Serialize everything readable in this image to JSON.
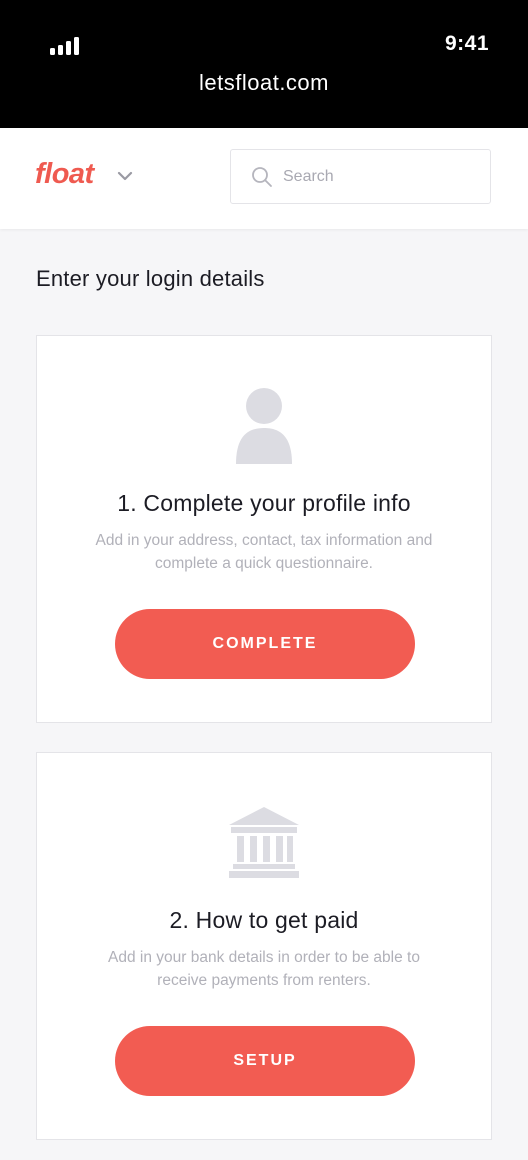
{
  "status_bar": {
    "time": "9:41",
    "url": "letsfloat.com"
  },
  "header": {
    "logo_text": "float",
    "logo_menu_icon": "chevron-down-icon",
    "search": {
      "icon": "search-icon",
      "placeholder": "Search"
    }
  },
  "page": {
    "title": "Enter your login details"
  },
  "cards": [
    {
      "icon": "user-icon",
      "title": "1. Complete your profile info",
      "description": "Add in your address, contact, tax information and complete a quick questionnaire.",
      "button_label": "COMPLETE"
    },
    {
      "icon": "bank-icon",
      "title": "2. How to get paid",
      "description": "Add in your bank details in order to be able to receive payments from renters.",
      "button_label": "SETUP"
    }
  ],
  "colors": {
    "accent": "#f25c52",
    "logo": "#ef5a50",
    "icon_gray": "#dcdce2",
    "background": "#f6f6f8"
  }
}
